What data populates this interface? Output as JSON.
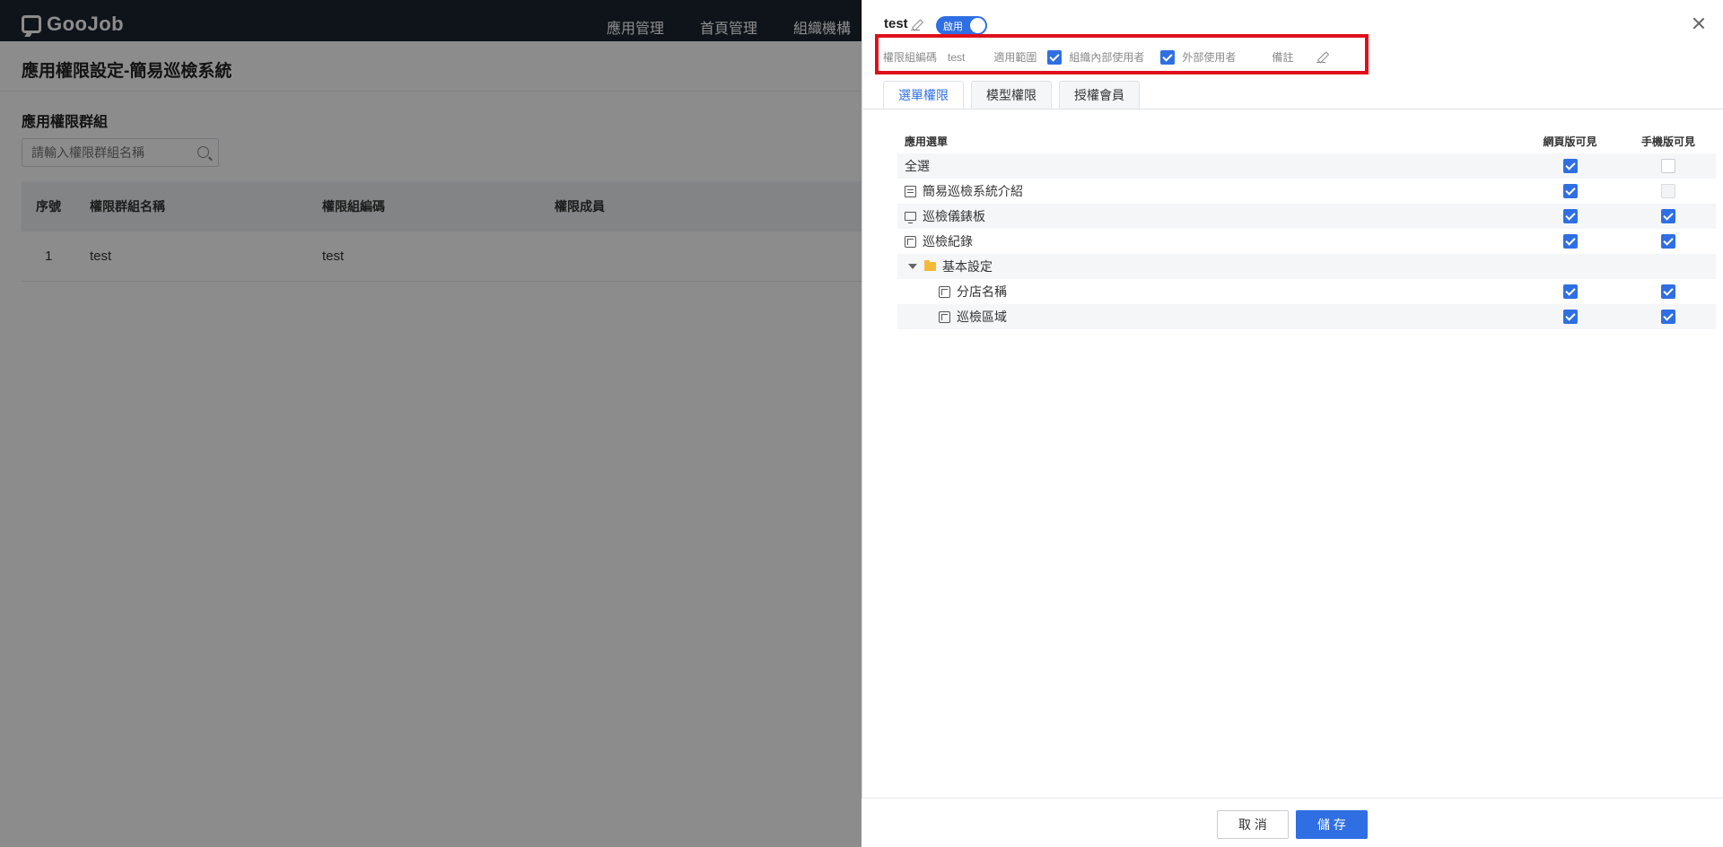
{
  "app": {
    "logo_text": "GooJob",
    "nav": [
      "應用管理",
      "首頁管理",
      "組織機構"
    ],
    "page_title": "應用權限設定-簡易巡檢系統",
    "section_title": "應用權限群組",
    "search_placeholder": "請輸入權限群組名稱",
    "table_headers": [
      "序號",
      "權限群組名稱",
      "權限組編碼",
      "權限成員"
    ],
    "table_rows": [
      {
        "index": "1",
        "name": "test",
        "code": "test",
        "members": ""
      }
    ]
  },
  "drawer": {
    "title": "test",
    "toggle_label": "啟用",
    "toggle_on": true,
    "info": {
      "code_label": "權限組編碼",
      "code_value": "test",
      "scope_label": "適用範圍",
      "scope_internal": "組織內部使用者",
      "scope_internal_checked": true,
      "scope_external": "外部使用者",
      "scope_external_checked": true,
      "remark_label": "備註"
    },
    "tabs": [
      "選單權限",
      "模型權限",
      "授權會員"
    ],
    "active_tab": 0,
    "perm_headers": {
      "menu": "應用選單",
      "web": "網頁版可見",
      "mobile": "手機版可見"
    },
    "perm_rows": [
      {
        "label": "全選",
        "icon": "",
        "web": "checked",
        "mobile": "unchecked"
      },
      {
        "label": "簡易巡檢系統介紹",
        "icon": "list-icon",
        "web": "checked",
        "mobile": "disabled"
      },
      {
        "label": "巡檢儀錶板",
        "icon": "monitor-icon",
        "web": "checked",
        "mobile": "checked"
      },
      {
        "label": "巡檢紀錄",
        "icon": "cube-icon",
        "web": "checked",
        "mobile": "checked"
      },
      {
        "label": "基本設定",
        "icon": "folder-icon",
        "web": "",
        "mobile": ""
      },
      {
        "label": "分店名稱",
        "icon": "cube-icon",
        "web": "checked",
        "mobile": "checked"
      },
      {
        "label": "巡檢區域",
        "icon": "cube-icon",
        "web": "checked",
        "mobile": "checked"
      }
    ],
    "buttons": {
      "cancel": "取 消",
      "save": "儲 存"
    }
  },
  "colors": {
    "primary": "#2f6fe3",
    "highlight_border": "#e0101a",
    "topbar": "#1d2330"
  }
}
